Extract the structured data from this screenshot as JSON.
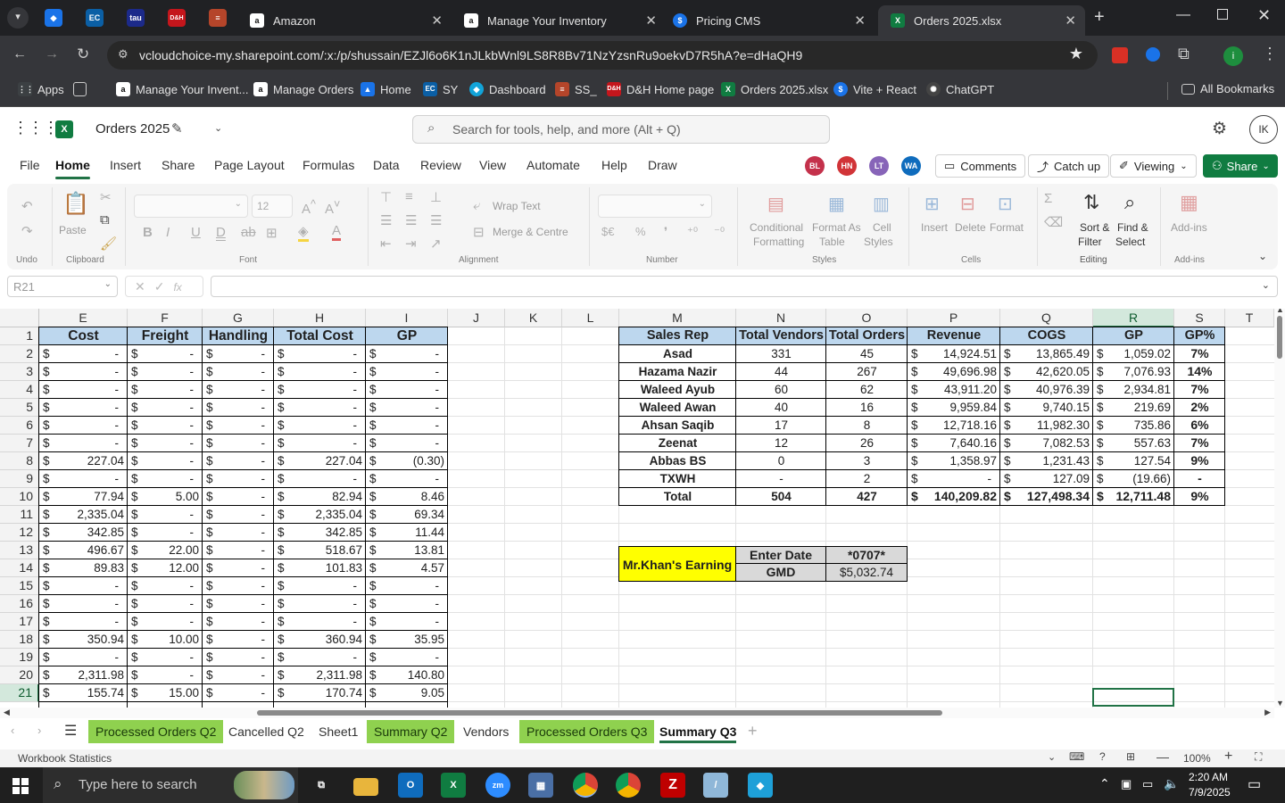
{
  "browser": {
    "tabs": [
      {
        "label": "Amazon",
        "icon": "amazon-icon"
      },
      {
        "label": "Manage Your Inventory",
        "icon": "amazon-icon"
      },
      {
        "label": "Pricing CMS",
        "icon": "dollar-icon"
      },
      {
        "label": "Orders 2025.xlsx",
        "icon": "excel-icon"
      }
    ],
    "pinned": [
      {
        "label": "EC"
      },
      {
        "label": "tau"
      },
      {
        "label": "D&H"
      }
    ],
    "url": "vcloudchoice-my.sharepoint.com/:x:/p/shussain/EZJl6o6K1nJLkbWnl9LS8R8Bv71NzYzsnRu9oekvD7R5hA?e=dHaQH9",
    "bookmarks": [
      "Apps",
      "Manage Your Invent...",
      "Manage Orders",
      "Home",
      "SY",
      "Dashboard",
      "SS_",
      "D&H Home page",
      "Orders 2025.xlsx",
      "Vite + React",
      "ChatGPT"
    ],
    "all_bookmarks": "All Bookmarks"
  },
  "excel": {
    "doc_title": "Orders 2025",
    "search_placeholder": "Search for tools, help, and more (Alt + Q)",
    "user_initials": "IK",
    "menus": [
      "File",
      "Home",
      "Insert",
      "Share",
      "Page Layout",
      "Formulas",
      "Data",
      "Review",
      "View",
      "Automate",
      "Help",
      "Draw"
    ],
    "collaborators": [
      {
        "initials": "BL",
        "color": "#c4314b"
      },
      {
        "initials": "HN",
        "color": "#d13438"
      },
      {
        "initials": "LT",
        "color": "#8764b8"
      },
      {
        "initials": "WA",
        "color": "#0f6cbd"
      }
    ],
    "comments_label": "Comments",
    "catchup_label": "Catch up",
    "viewing_label": "Viewing",
    "share_label": "Share",
    "ribbon": {
      "undo_group": "Undo",
      "clipboard_group": "Clipboard",
      "paste_label": "Paste",
      "font_group": "Font",
      "font_size": "12",
      "alignment_group": "Alignment",
      "wrap_text": "Wrap Text",
      "merge_centre": "Merge & Centre",
      "number_group": "Number",
      "styles_group": "Styles",
      "cond_format_1": "Conditional",
      "cond_format_2": "Formatting",
      "format_table_1": "Format As",
      "format_table_2": "Table",
      "cell_styles_1": "Cell",
      "cell_styles_2": "Styles",
      "cells_group": "Cells",
      "insert_label": "Insert",
      "delete_label": "Delete",
      "format_label": "Format",
      "editing_group": "Editing",
      "sort_1": "Sort &",
      "sort_2": "Filter",
      "find_1": "Find &",
      "find_2": "Select",
      "addins_group": "Add-ins",
      "addins_label": "Add-ins"
    },
    "name_box": "R21",
    "columns": [
      "E",
      "F",
      "G",
      "H",
      "I",
      "J",
      "K",
      "L",
      "M",
      "N",
      "O",
      "P",
      "Q",
      "R",
      "S",
      "T"
    ],
    "rows": [
      "1",
      "2",
      "3",
      "4",
      "5",
      "6",
      "7",
      "8",
      "9",
      "10",
      "11",
      "12",
      "13",
      "14",
      "15",
      "16",
      "17",
      "18",
      "19",
      "20",
      "21"
    ],
    "left_table": {
      "headers": [
        "Cost",
        "Freight",
        "Handling",
        "Total Cost",
        "GP"
      ],
      "rows": [
        [
          "-",
          "-",
          "-",
          "-",
          "-"
        ],
        [
          "-",
          "-",
          "-",
          "-",
          "-"
        ],
        [
          "-",
          "-",
          "-",
          "-",
          "-"
        ],
        [
          "-",
          "-",
          "-",
          "-",
          "-"
        ],
        [
          "-",
          "-",
          "-",
          "-",
          "-"
        ],
        [
          "-",
          "-",
          "-",
          "-",
          "-"
        ],
        [
          "227.04",
          "-",
          "-",
          "227.04",
          "(0.30)"
        ],
        [
          "-",
          "-",
          "-",
          "-",
          "-"
        ],
        [
          "77.94",
          "5.00",
          "-",
          "82.94",
          "8.46"
        ],
        [
          "2,335.04",
          "-",
          "-",
          "2,335.04",
          "69.34"
        ],
        [
          "342.85",
          "-",
          "-",
          "342.85",
          "11.44"
        ],
        [
          "496.67",
          "22.00",
          "-",
          "518.67",
          "13.81"
        ],
        [
          "89.83",
          "12.00",
          "-",
          "101.83",
          "4.57"
        ],
        [
          "-",
          "-",
          "-",
          "-",
          "-"
        ],
        [
          "-",
          "-",
          "-",
          "-",
          "-"
        ],
        [
          "-",
          "-",
          "-",
          "-",
          "-"
        ],
        [
          "350.94",
          "10.00",
          "-",
          "360.94",
          "35.95"
        ],
        [
          "-",
          "-",
          "-",
          "-",
          "-"
        ],
        [
          "2,311.98",
          "-",
          "-",
          "2,311.98",
          "140.80"
        ],
        [
          "155.74",
          "15.00",
          "-",
          "170.74",
          "9.05"
        ]
      ]
    },
    "summary_table": {
      "headers": [
        "Sales Rep",
        "Total Vendors",
        "Total Orders",
        "Revenue",
        "COGS",
        "GP",
        "GP%"
      ],
      "rows": [
        [
          "Asad",
          "331",
          "45",
          "14,924.51",
          "13,865.49",
          "1,059.02",
          "7%"
        ],
        [
          "Hazama Nazir",
          "44",
          "267",
          "49,696.98",
          "42,620.05",
          "7,076.93",
          "14%"
        ],
        [
          "Waleed Ayub",
          "60",
          "62",
          "43,911.20",
          "40,976.39",
          "2,934.81",
          "7%"
        ],
        [
          "Waleed Awan",
          "40",
          "16",
          "9,959.84",
          "9,740.15",
          "219.69",
          "2%"
        ],
        [
          "Ahsan Saqib",
          "17",
          "8",
          "12,718.16",
          "11,982.30",
          "735.86",
          "6%"
        ],
        [
          "Zeenat",
          "12",
          "26",
          "7,640.16",
          "7,082.53",
          "557.63",
          "7%"
        ],
        [
          "Abbas BS",
          "0",
          "3",
          "1,358.97",
          "1,231.43",
          "127.54",
          "9%"
        ],
        [
          "TXWH",
          "-",
          "2",
          "-",
          "127.09",
          "(19.66)",
          "-"
        ]
      ],
      "total": [
        "Total",
        "504",
        "427",
        "140,209.82",
        "127,498.34",
        "12,711.48",
        "9%"
      ]
    },
    "earning": {
      "label": "Mr.Khan's Earning",
      "date_label": "Enter Date",
      "date_value": "*0707*",
      "gmd_label": "GMD",
      "gmd_value": "$5,032.74"
    },
    "currency": "$",
    "sheet_tabs": [
      {
        "label": "Processed Orders Q2",
        "green": true
      },
      {
        "label": "Cancelled Q2",
        "green": false
      },
      {
        "label": "Sheet1",
        "green": false
      },
      {
        "label": "Summary Q2",
        "green": true
      },
      {
        "label": "Vendors",
        "green": false
      },
      {
        "label": "Processed Orders Q3",
        "green": true
      },
      {
        "label": "Summary Q3",
        "green": false,
        "active": true
      }
    ],
    "status_left": "Workbook Statistics",
    "zoom": "100%"
  },
  "taskbar": {
    "search_placeholder": "Type here to search",
    "time": "2:20 AM",
    "date": "7/9/2025"
  }
}
